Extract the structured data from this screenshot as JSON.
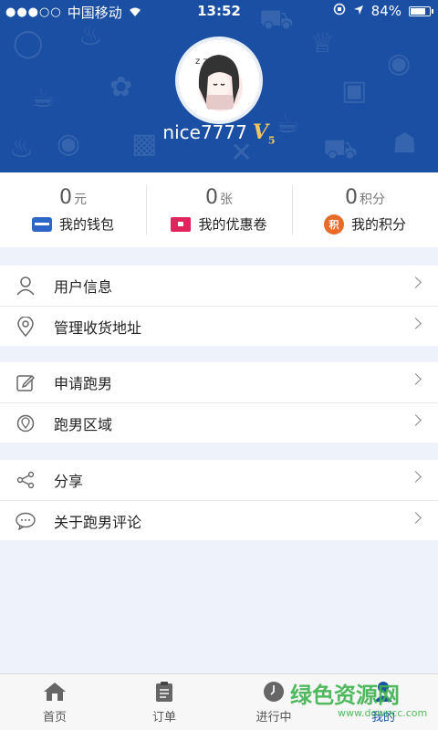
{
  "status_bar": {
    "carrier": "中国移动",
    "time": "13:52",
    "battery": "84%",
    "battery_level": 0.84
  },
  "profile": {
    "username": "nice7777",
    "vip_level": "V",
    "vip_sub": "5"
  },
  "stats": [
    {
      "value": "0",
      "unit": "元",
      "label": "我的钱包",
      "icon": "wallet-icon"
    },
    {
      "value": "0",
      "unit": "张",
      "label": "我的优惠卷",
      "icon": "coupon-icon"
    },
    {
      "value": "0",
      "unit": "积分",
      "label": "我的积分",
      "icon": "points-icon",
      "icon_text": "积"
    }
  ],
  "menu": {
    "group1": [
      {
        "label": "用户信息",
        "icon": "user-icon"
      },
      {
        "label": "管理收货地址",
        "icon": "location-pin-icon"
      }
    ],
    "group2": [
      {
        "label": "申请跑男",
        "icon": "edit-icon"
      },
      {
        "label": "跑男区域",
        "icon": "area-pin-icon"
      }
    ],
    "group3": [
      {
        "label": "分享",
        "icon": "share-icon"
      },
      {
        "label": "关于跑男评论",
        "icon": "comment-icon"
      }
    ]
  },
  "tabbar": {
    "tabs": [
      {
        "label": "首页",
        "icon": "home-icon"
      },
      {
        "label": "订单",
        "icon": "clipboard-icon"
      },
      {
        "label": "进行中",
        "icon": "clock-icon"
      },
      {
        "label": "我的",
        "icon": "person-icon",
        "active": true
      }
    ]
  },
  "watermark": {
    "title": "绿色资源网",
    "url": "www.downcc.com"
  },
  "colors": {
    "header_blue": "#1b4fa3",
    "wallet_blue": "#2d66c6",
    "coupon_red": "#e0245e",
    "points_orange": "#e86a2a",
    "page_bg": "#eef3fb"
  }
}
